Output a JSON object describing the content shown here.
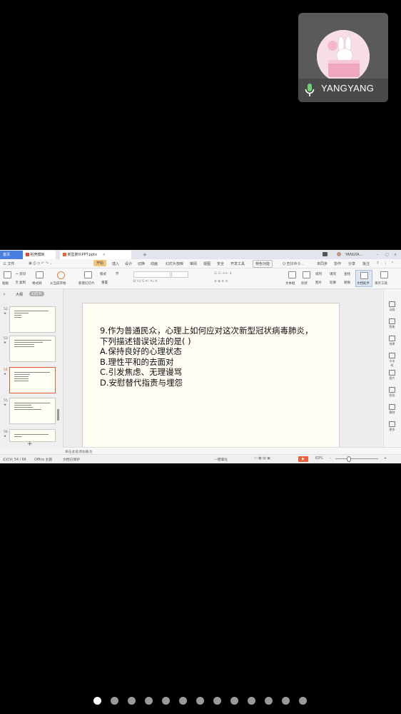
{
  "participant": {
    "name": "YANGYANG",
    "avatar_icon": "bunny-avatar-icon"
  },
  "app": {
    "tabs": [
      {
        "label": "首页"
      },
      {
        "label": "稻壳模板"
      },
      {
        "label": "新型肺炎PPT.pptx"
      }
    ],
    "new_tab": "+",
    "user_label": "YANGYA...",
    "menu": {
      "file": "三 文件",
      "items": [
        "开始",
        "插入",
        "设计",
        "切换",
        "动画",
        "幻灯片放映",
        "审阅",
        "视图",
        "安全",
        "开发工具",
        "特色功能"
      ],
      "active": "开始",
      "search": "Q 查找命令...",
      "sync": "未同步",
      "share": "协作",
      "comment": "分享",
      "batch": "批注"
    },
    "ribbon": {
      "paste": "粘贴",
      "cut": "剪切",
      "copy": "复制",
      "format": "格式刷",
      "from_current": "从当前开始",
      "new_slide": "新建幻灯片",
      "layout": "版式",
      "reset": "重置",
      "section": "节",
      "text_box": "文本框",
      "shapes": "形状",
      "arrange": "排列",
      "picture": "图片",
      "fill": "填充",
      "outline": "轮廓",
      "find": "查找",
      "replace": "替换",
      "select": "选择",
      "doc_helper": "文档助手",
      "slide_show": "演示工具"
    },
    "panel_tabs": {
      "outline": "大纲",
      "slides": "幻灯片"
    },
    "thumbnails": [
      {
        "num": "52",
        "star": "★"
      },
      {
        "num": "53",
        "star": "★"
      },
      {
        "num": "54",
        "star": "★"
      },
      {
        "num": "55",
        "star": "★"
      },
      {
        "num": "56",
        "star": "★"
      }
    ],
    "add_slide": "+",
    "slide": {
      "question_line1": "9.作为普通民众，心理上如何应对这次新型冠状病毒肺炎，",
      "question_line2": "下列描述错误说法的是(    )",
      "options": [
        "A.保持良好的心理状态",
        "B.理性平和的去面对",
        "C.引发焦虑、无理谩骂",
        "D.安慰替代指责与埋怨"
      ]
    },
    "right_tools": [
      "动画",
      "智能",
      "效果",
      "文本框",
      "图片",
      "图形",
      "删除",
      "更多"
    ],
    "notes_placeholder": "单击此处添加备注",
    "status": {
      "slide_counter": "幻灯片 54 / 66",
      "theme": "Office 主题",
      "protect": "文档已保护",
      "beautify": "一键美化",
      "zoom": "63%",
      "plus": "+",
      "minus": "-"
    }
  },
  "pager": {
    "count": 13,
    "active_index": 0
  }
}
